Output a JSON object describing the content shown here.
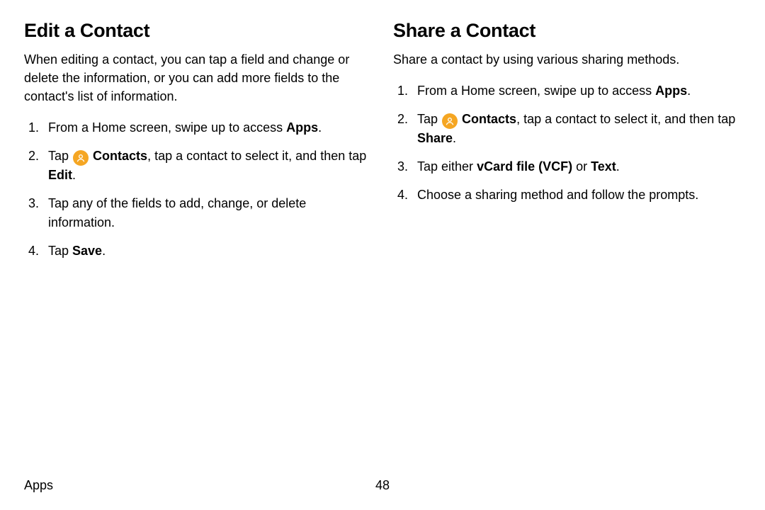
{
  "left": {
    "heading": "Edit a Contact",
    "intro": "When editing a contact, you can tap a field and change or delete the information, or you can add more fields to the contact's list of information.",
    "steps": {
      "s1_pre": "From a Home screen, swipe up to access ",
      "s1_bold": "Apps",
      "s1_post": ".",
      "s2_pre": "Tap ",
      "s2_bold1": "Contacts",
      "s2_mid": ", tap a contact to select it, and then tap ",
      "s2_bold2": "Edit",
      "s2_post": ".",
      "s3": "Tap any of the fields to add, change, or delete information.",
      "s4_pre": "Tap ",
      "s4_bold": "Save",
      "s4_post": "."
    }
  },
  "right": {
    "heading": "Share a Contact",
    "intro": "Share a contact by using various sharing methods.",
    "steps": {
      "s1_pre": "From a Home screen, swipe up to access ",
      "s1_bold": "Apps",
      "s1_post": ".",
      "s2_pre": "Tap ",
      "s2_bold1": "Contacts",
      "s2_mid": ", tap a contact to select it, and then tap ",
      "s2_bold2": "Share",
      "s2_post": ".",
      "s3_pre": "Tap either ",
      "s3_bold1": "vCard file (VCF)",
      "s3_mid": " or ",
      "s3_bold2": "Text",
      "s3_post": ".",
      "s4": "Choose a sharing method and follow the prompts."
    }
  },
  "footer": {
    "section": "Apps",
    "page": "48"
  },
  "icons": {
    "contacts": "contacts-icon"
  }
}
